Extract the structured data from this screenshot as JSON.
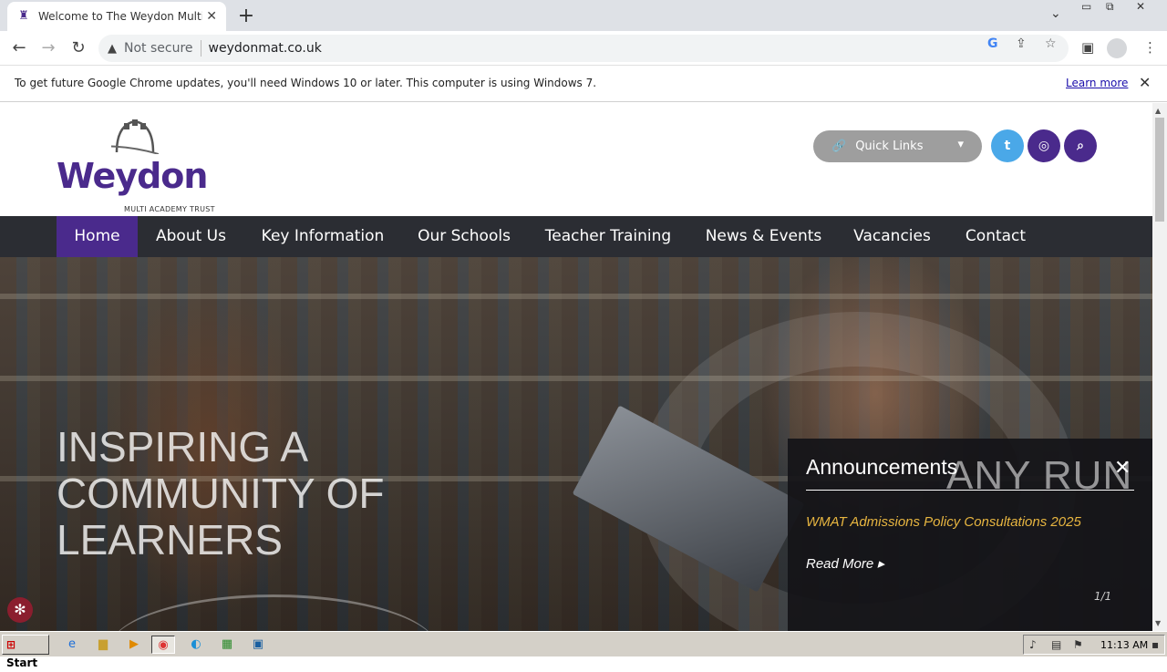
{
  "browser": {
    "tab_title": "Welcome to The Weydon Multi Academy Trust",
    "new_tab_icon": "plus-icon",
    "address": {
      "security_label": "Not secure",
      "url": "weydonmat.co.uk"
    },
    "infobar": {
      "message": "To get future Google Chrome updates, you'll need Windows 10 or later. This computer is using Windows 7.",
      "link": "Learn more"
    }
  },
  "site": {
    "logo": {
      "wordmark": "Weydon",
      "subtitle": "MULTI ACADEMY TRUST"
    },
    "quick_links_label": "Quick Links",
    "colors": {
      "brand_purple": "#4a2a8c",
      "twitter_blue": "#4aa8e8",
      "nav_dark": "#2b2d33",
      "announcement_gold": "#e7b540"
    },
    "nav": [
      {
        "label": "Home",
        "active": true
      },
      {
        "label": "About Us"
      },
      {
        "label": "Key Information"
      },
      {
        "label": "Our Schools"
      },
      {
        "label": "Teacher Training"
      },
      {
        "label": "News & Events"
      },
      {
        "label": "Vacancies"
      },
      {
        "label": "Contact"
      }
    ],
    "hero": {
      "headline": [
        "INSPIRING A",
        "COMMUNITY OF",
        "LEARNERS"
      ]
    },
    "announcements": {
      "heading": "Announcements",
      "item": "WMAT Admissions Policy Consultations 2025",
      "read_more": "Read More",
      "counter": "1/1"
    }
  },
  "watermark": "ANY RUN",
  "taskbar": {
    "start_label": "Start",
    "clock": "11:13 AM"
  }
}
